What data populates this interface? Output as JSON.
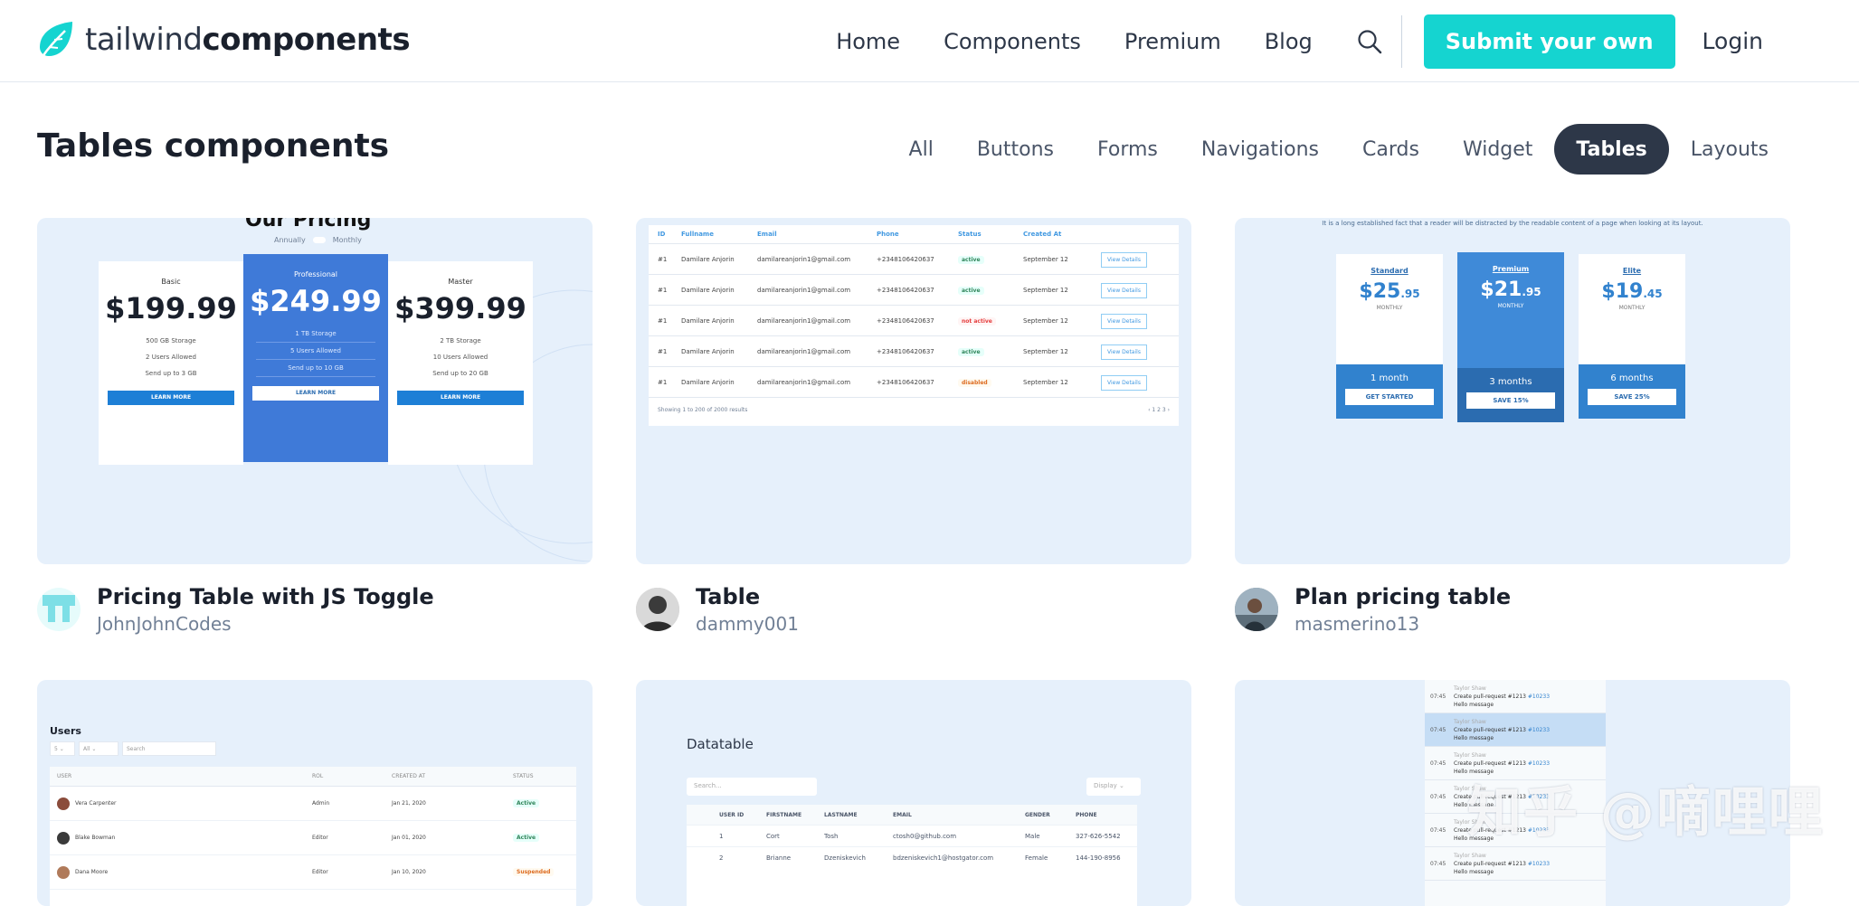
{
  "header": {
    "logo_light": "tailwind",
    "logo_bold": "components",
    "nav": [
      "Home",
      "Components",
      "Premium",
      "Blog"
    ],
    "submit_label": "Submit your own",
    "login_label": "Login",
    "accent_color": "#15d4d0"
  },
  "page": {
    "title": "Tables components",
    "filters": [
      "All",
      "Buttons",
      "Forms",
      "Navigations",
      "Cards",
      "Widget",
      "Tables",
      "Layouts"
    ],
    "active_filter": "Tables"
  },
  "cards": [
    {
      "title": "Pricing Table with JS Toggle",
      "author": "JohnJohnCodes",
      "preview": {
        "heading": "Our Pricing",
        "toggle": [
          "Annually",
          "Monthly"
        ],
        "plans": [
          {
            "name": "Basic",
            "price": "$199.99",
            "features": [
              "500 GB Storage",
              "2 Users Allowed",
              "Send up to 3 GB"
            ],
            "button": "LEARN MORE"
          },
          {
            "name": "Professional",
            "price": "$249.99",
            "features": [
              "1 TB Storage",
              "5 Users Allowed",
              "Send up to 10 GB"
            ],
            "button": "LEARN MORE"
          },
          {
            "name": "Master",
            "price": "$399.99",
            "features": [
              "2 TB Storage",
              "10 Users Allowed",
              "Send up to 20 GB"
            ],
            "button": "LEARN MORE"
          }
        ]
      }
    },
    {
      "title": "Table",
      "author": "dammy001",
      "preview": {
        "columns": [
          "ID",
          "Fullname",
          "Email",
          "Phone",
          "Status",
          "Created At",
          ""
        ],
        "rows": [
          {
            "id": "#1",
            "name": "Damilare Anjorin",
            "email": "damilareanjorin1@gmail.com",
            "phone": "+2348106420637",
            "status": "active",
            "date": "September 12",
            "action": "View Details"
          },
          {
            "id": "#1",
            "name": "Damilare Anjorin",
            "email": "damilareanjorin1@gmail.com",
            "phone": "+2348106420637",
            "status": "active",
            "date": "September 12",
            "action": "View Details"
          },
          {
            "id": "#1",
            "name": "Damilare Anjorin",
            "email": "damilareanjorin1@gmail.com",
            "phone": "+2348106420637",
            "status": "not active",
            "date": "September 12",
            "action": "View Details"
          },
          {
            "id": "#1",
            "name": "Damilare Anjorin",
            "email": "damilareanjorin1@gmail.com",
            "phone": "+2348106420637",
            "status": "active",
            "date": "September 12",
            "action": "View Details"
          },
          {
            "id": "#1",
            "name": "Damilare Anjorin",
            "email": "damilareanjorin1@gmail.com",
            "phone": "+2348106420637",
            "status": "disabled",
            "date": "September 12",
            "action": "View Details"
          }
        ],
        "footer": "Showing 1 to 200 of 2000 results",
        "pager": "‹  1  2  3  ›"
      }
    },
    {
      "title": "Plan pricing table",
      "author": "masmerino13",
      "preview": {
        "intro": "It is a long established fact that a reader will be distracted by the readable content of a page when looking at its layout.",
        "plans": [
          {
            "name": "Standard",
            "price": "$25",
            "cents": ".95",
            "period": "MONTHLY",
            "duration": "1 month",
            "button": "GET STARTED"
          },
          {
            "name": "Premium",
            "price": "$21",
            "cents": ".95",
            "period": "MONTHLY",
            "duration": "3 months",
            "button": "SAVE 15%"
          },
          {
            "name": "Elite",
            "price": "$19",
            "cents": ".45",
            "period": "MONTHLY",
            "duration": "6 months",
            "button": "SAVE 25%"
          }
        ]
      }
    },
    {
      "preview": {
        "title": "Users",
        "controls": [
          "5 ⌄",
          "All ⌄",
          "Search"
        ],
        "columns": [
          "USER",
          "ROL",
          "CREATED AT",
          "STATUS"
        ],
        "rows": [
          {
            "name": "Vera Carpenter",
            "role": "Admin",
            "date": "Jan 21, 2020",
            "status": "Active"
          },
          {
            "name": "Blake Bowman",
            "role": "Editor",
            "date": "Jan 01, 2020",
            "status": "Active"
          },
          {
            "name": "Dana Moore",
            "role": "Editor",
            "date": "Jan 10, 2020",
            "status": "Suspended"
          }
        ]
      }
    },
    {
      "preview": {
        "title": "Datatable",
        "search": "Search...",
        "display": "Display ⌄",
        "columns": [
          "",
          "USER ID",
          "FIRSTNAME",
          "LASTNAME",
          "EMAIL",
          "GENDER",
          "PHONE"
        ],
        "rows": [
          {
            "n": "",
            "id": "1",
            "first": "Cort",
            "last": "Tosh",
            "email": "ctosh0@github.com",
            "gender": "Male",
            "phone": "327-626-5542"
          },
          {
            "n": "",
            "id": "2",
            "first": "Brianne",
            "last": "Dzeniskevich",
            "email": "bdzeniskevich1@hostgator.com",
            "gender": "Female",
            "phone": "144-190-8956"
          }
        ]
      }
    },
    {
      "preview": {
        "items": [
          {
            "time": "07:45",
            "who": "Taylor Shaw",
            "text": "Create pull-request #1213",
            "link": "#10233",
            "note": "Hello message"
          },
          {
            "time": "07:45",
            "who": "Taylor Shaw",
            "text": "Create pull-request #1213",
            "link": "#10233",
            "note": "Hello message"
          },
          {
            "time": "07:45",
            "who": "Taylor Shaw",
            "text": "Create pull-request #1213",
            "link": "#10233",
            "note": "Hello message"
          },
          {
            "time": "07:45",
            "who": "Taylor Shaw",
            "text": "Create pull-request #1213",
            "link": "#10233",
            "note": "Hello message"
          },
          {
            "time": "07:45",
            "who": "Taylor Shaw",
            "text": "Create pull-request #1213",
            "link": "#10233",
            "note": "Hello message"
          },
          {
            "time": "07:45",
            "who": "Taylor Shaw",
            "text": "Create pull-request #1213",
            "link": "#10233",
            "note": "Hello message"
          }
        ]
      }
    }
  ],
  "watermark": "知乎 @嘀哩哩"
}
